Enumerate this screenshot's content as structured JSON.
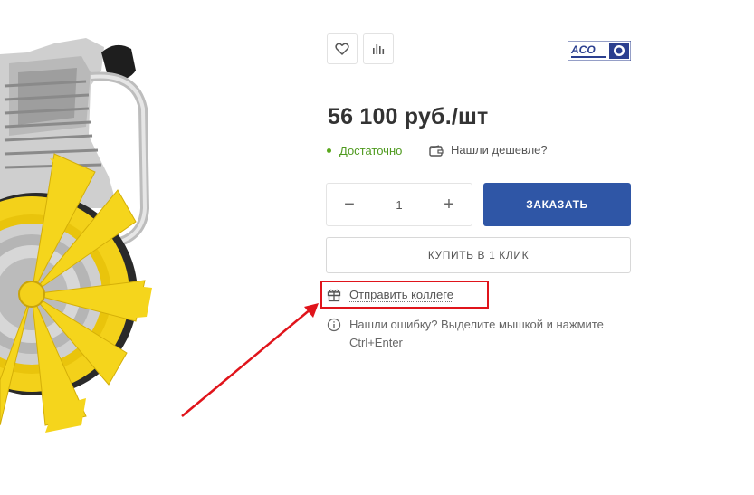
{
  "brand": {
    "logo_text": "ACO",
    "icon": "brand-logo-icon"
  },
  "actions": {
    "favorite_icon": "heart-icon",
    "compare_icon": "bar-chart-icon"
  },
  "product": {
    "price": "56 100 руб./шт",
    "stock_status": "Достаточно",
    "stock_color": "#4f9a1f",
    "cheaper_link": "Нашли дешевле?"
  },
  "quantity": {
    "minus": "−",
    "value": "1",
    "plus": "+"
  },
  "buttons": {
    "order": "ЗАКАЗАТЬ",
    "order_color": "#2f56a6",
    "one_click": "КУПИТЬ В 1 КЛИК"
  },
  "share": {
    "send_colleague": "Отправить коллеге",
    "icon": "gift-icon"
  },
  "hint": {
    "error_text": "Нашли ошибку? Выделите мышкой и нажмите Ctrl+Enter",
    "icon": "info-icon"
  },
  "annotation": {
    "highlight_color": "#e0141b"
  }
}
